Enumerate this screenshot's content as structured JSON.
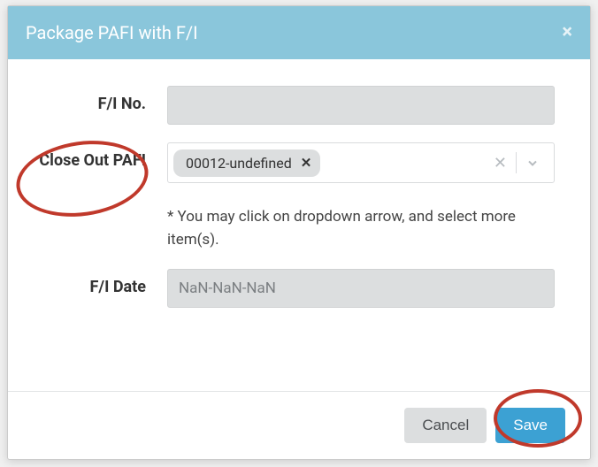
{
  "modal": {
    "title": "Package PAFI with F/I",
    "close_icon": "×"
  },
  "form": {
    "fi_no": {
      "label": "F/I No.",
      "value": ""
    },
    "close_out": {
      "label": "Close Out PAFI",
      "tag_value": "00012-undefined",
      "tag_remove": "✕",
      "clear_icon": "✕",
      "helper": "* You may click on dropdown arrow, and select more item(s)."
    },
    "fi_date": {
      "label": "F/I Date",
      "value": "NaN-NaN-NaN"
    }
  },
  "footer": {
    "cancel": "Cancel",
    "save": "Save"
  }
}
